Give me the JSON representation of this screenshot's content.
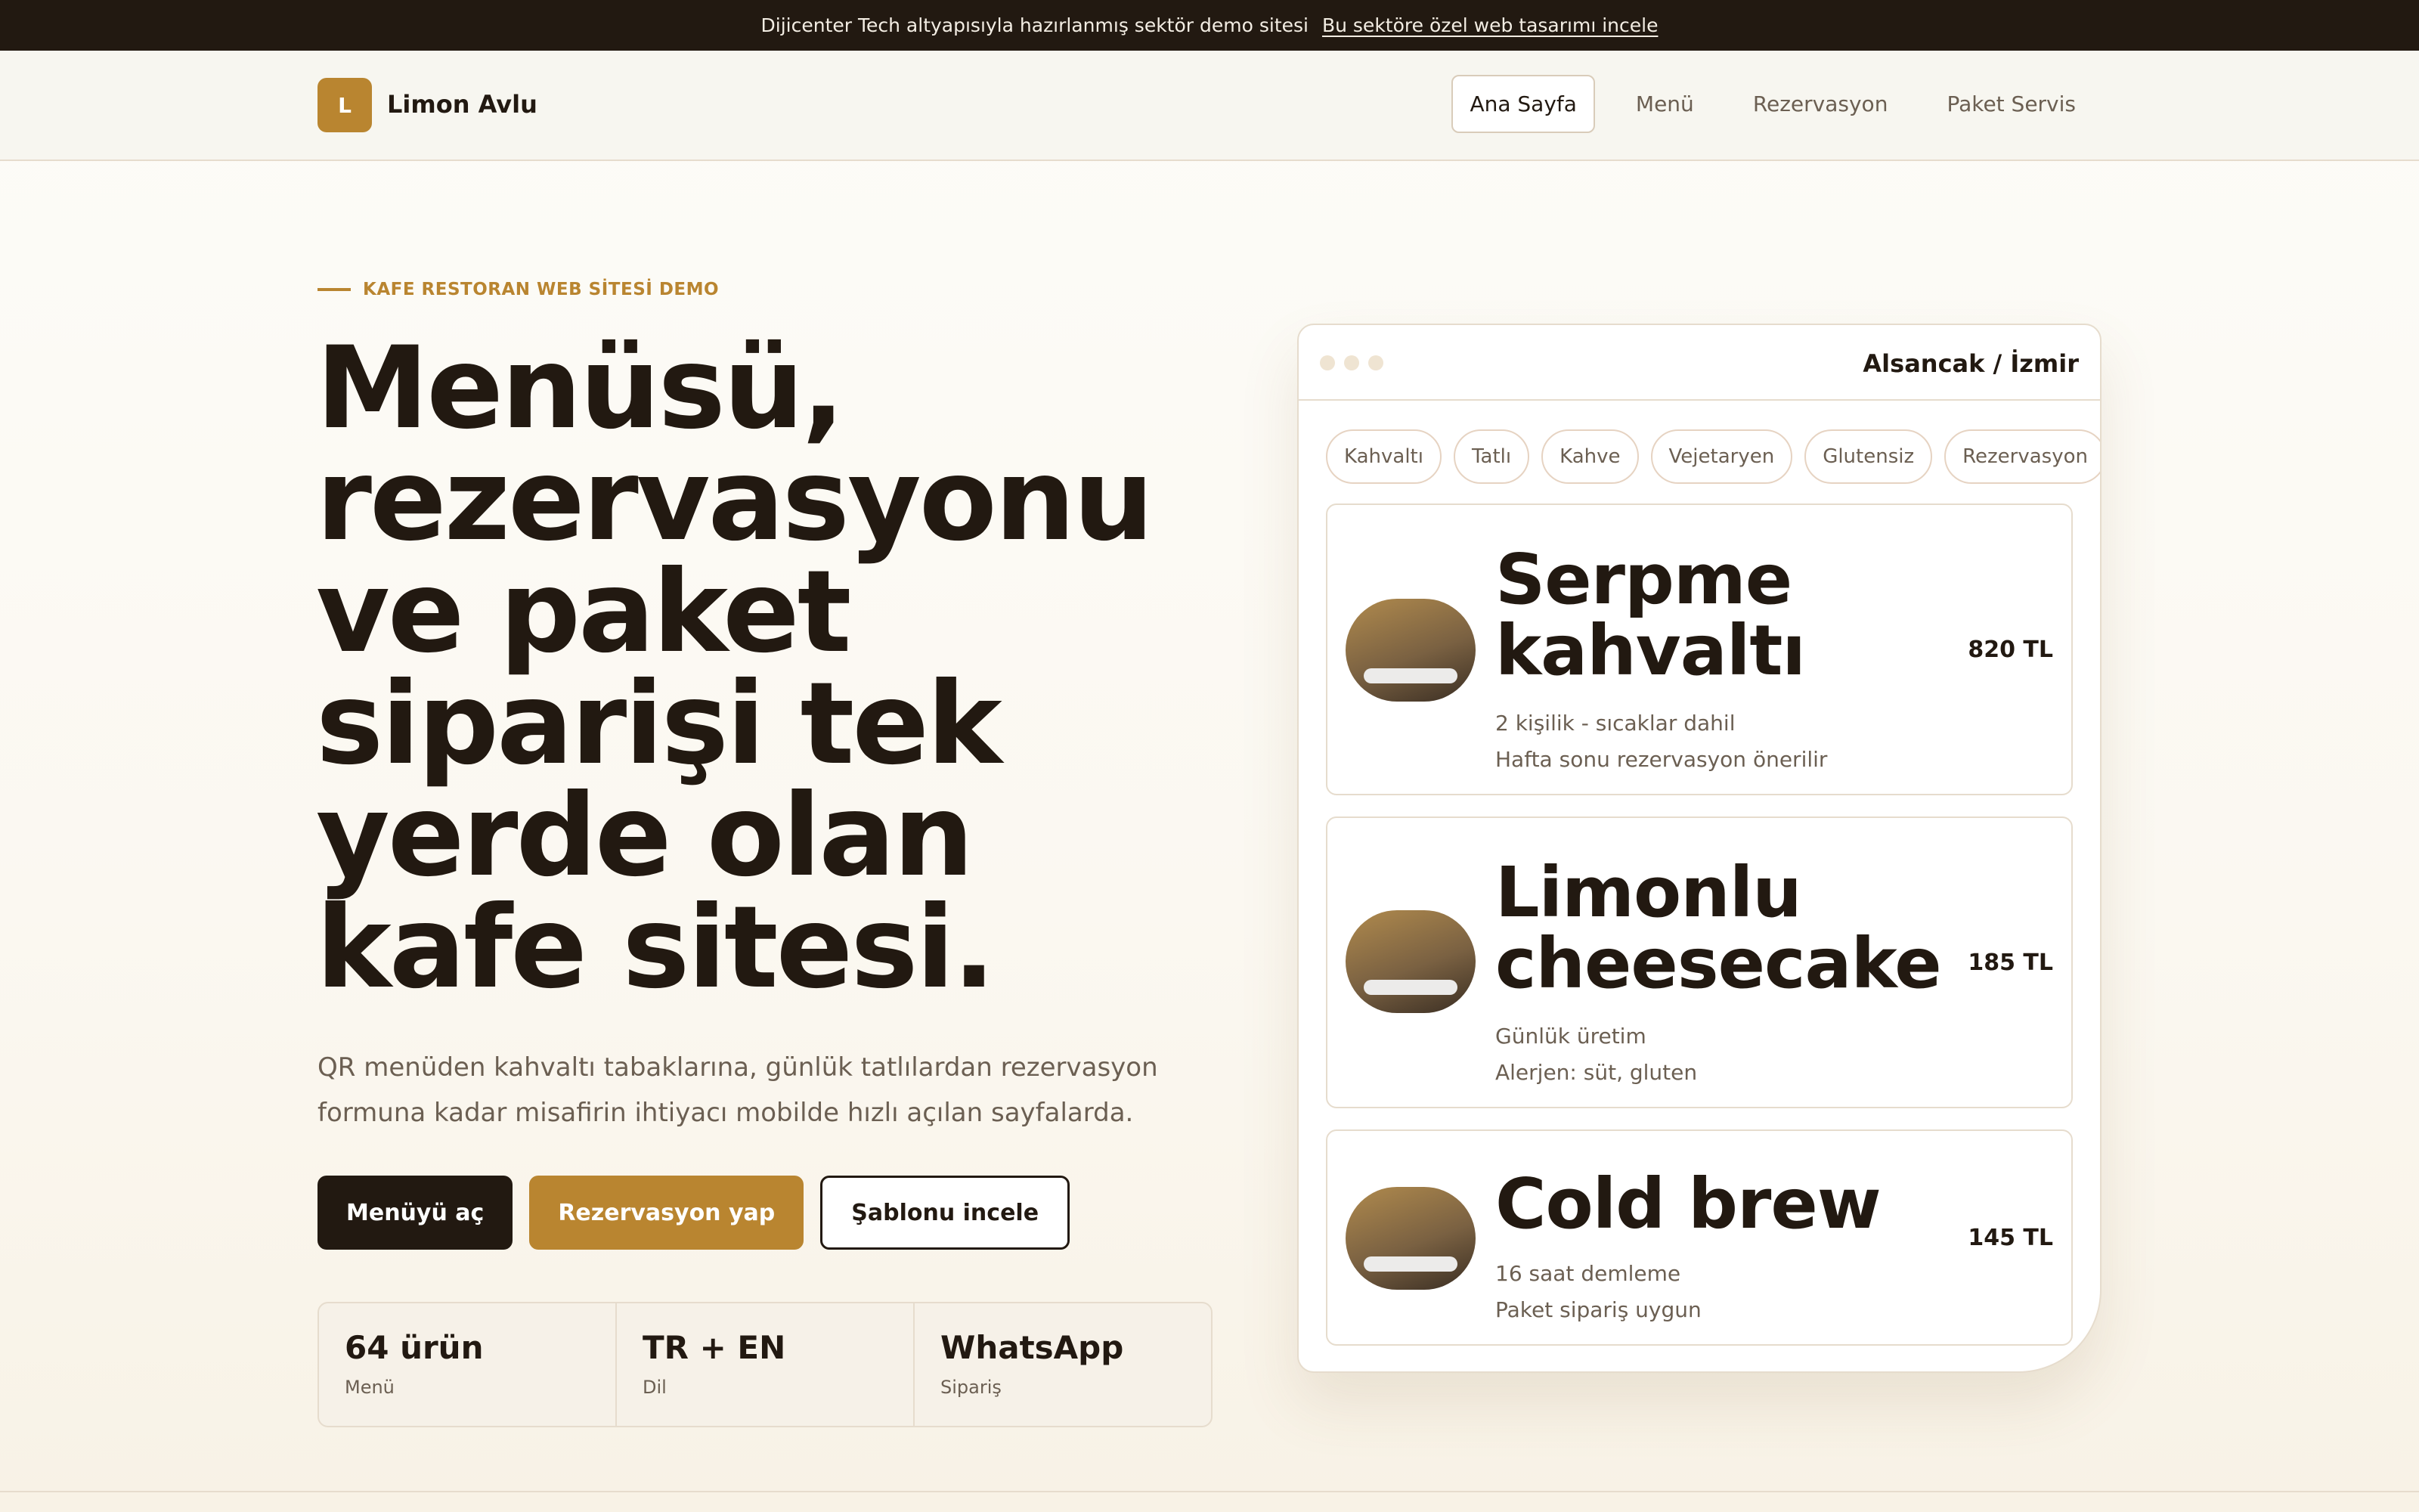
{
  "topbar": {
    "text": "Dijicenter Tech altyapısıyla hazırlanmış sektör demo sitesi",
    "link": "Bu sektöre özel web tasarımı incele"
  },
  "brand": {
    "mark": "L",
    "name": "Limon Avlu",
    "color": "#b98530"
  },
  "nav": [
    "Ana Sayfa",
    "Menü",
    "Rezervasyon",
    "Paket Servis"
  ],
  "hero": {
    "eyebrow": "KAFE RESTORAN WEB SİTESİ DEMO",
    "title_lines": [
      "Menüsü,",
      "rezervasyonu",
      "ve paket",
      "siparişi tek",
      "yerde olan",
      "kafe sitesi."
    ],
    "subtitle": "QR menüden kahvaltı tabaklarına, günlük tatlılardan rezervasyon formuna kadar misafirin ihtiyacı mobilde hızlı açılan sayfalarda.",
    "buttons": [
      "Menüyü aç",
      "Rezervasyon yap",
      "Şablonu incele"
    ]
  },
  "stats": [
    {
      "value": "64 ürün",
      "label": "Menü"
    },
    {
      "value": "TR + EN",
      "label": "Dil"
    },
    {
      "value": "WhatsApp",
      "label": "Sipariş"
    }
  ],
  "mock": {
    "location": "Alsancak / İzmir",
    "chips": [
      "Kahvaltı",
      "Tatlı",
      "Kahve",
      "Vejetaryen",
      "Glutensiz",
      "Rezervasyon"
    ],
    "items": [
      {
        "title_lines": [
          "Serpme",
          "kahvaltı"
        ],
        "price": "820 TL",
        "details": [
          "2 kişilik - sıcaklar dahil",
          "Hafta sonu rezervasyon önerilir"
        ]
      },
      {
        "title_lines": [
          "Limonlu",
          "cheesecake"
        ],
        "price": "185 TL",
        "details": [
          "Günlük üretim",
          "Alerjen: süt, gluten"
        ]
      },
      {
        "title_lines": [
          "Cold brew"
        ],
        "price": "145 TL",
        "details": [
          "16 saat demleme",
          "Paket sipariş uygun"
        ]
      }
    ]
  }
}
